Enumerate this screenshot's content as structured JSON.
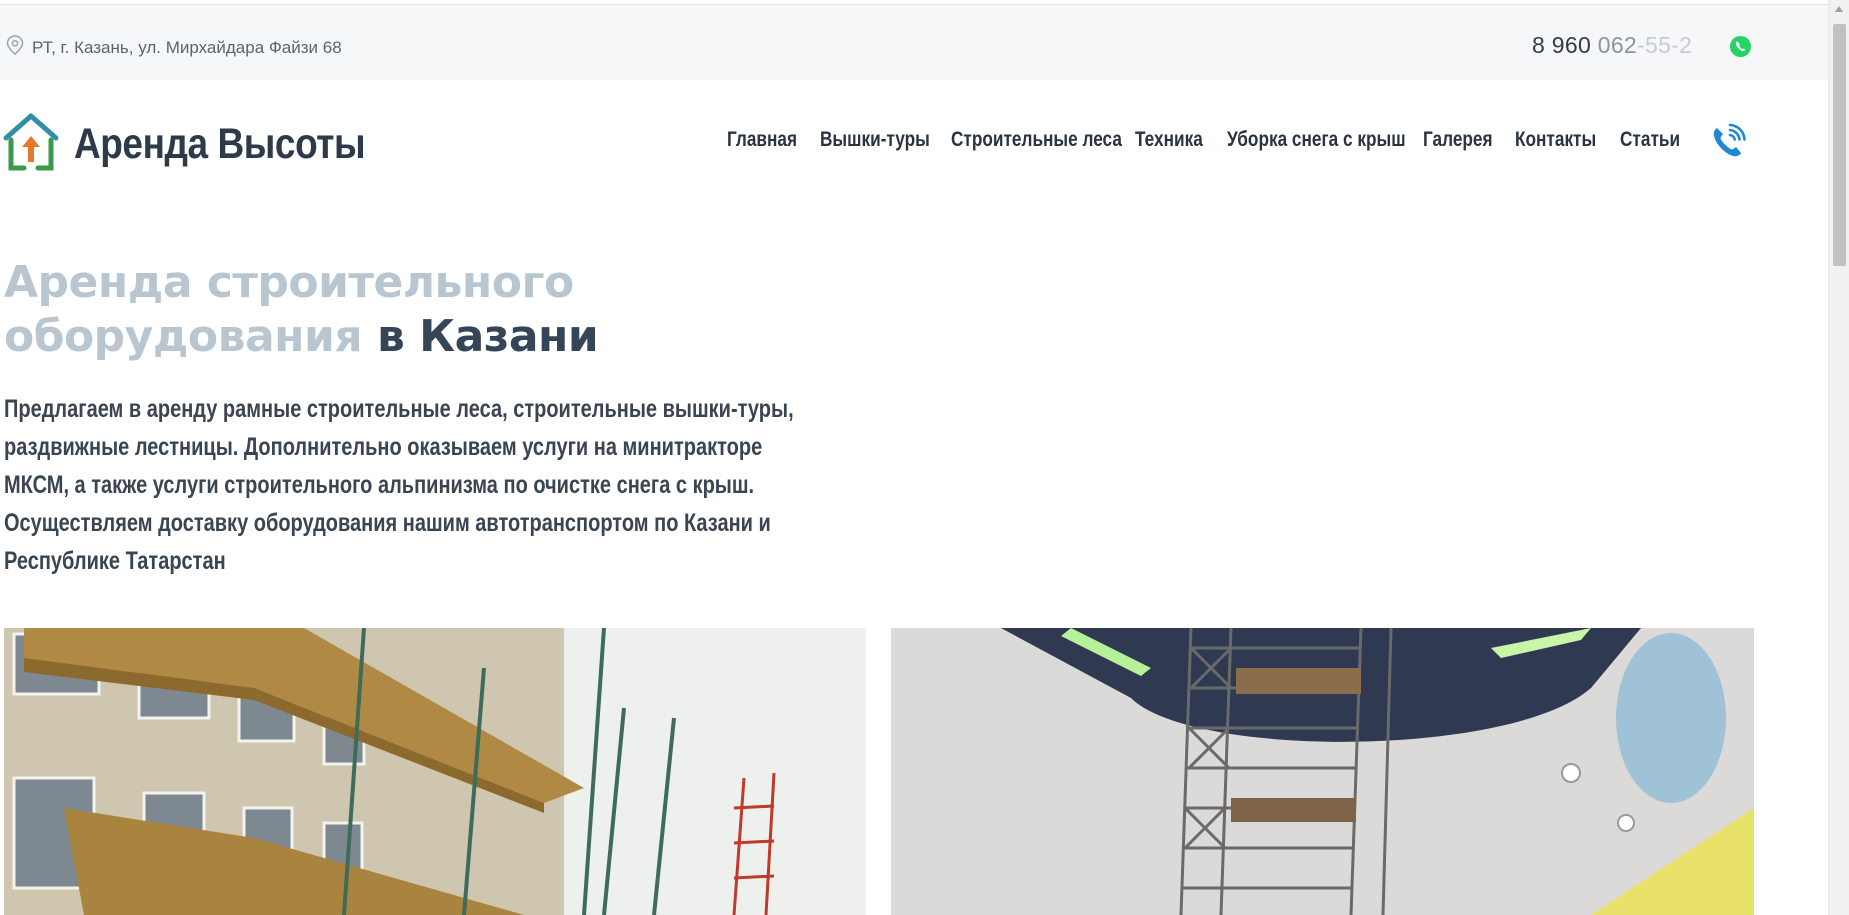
{
  "topbar": {
    "address": "РТ, г. Казань, ул. Мирхайдара Файзи 68",
    "phone_part_a": "8 960 ",
    "phone_part_b": "062",
    "phone_part_c": "-55-2",
    "location_icon": "location-pin-icon",
    "whatsapp_icon": "whatsapp-icon"
  },
  "logo": {
    "text": "Аренда Высоты",
    "icon": "house-up-arrow-logo"
  },
  "nav": {
    "items": [
      {
        "label": "Главная"
      },
      {
        "label": "Вышки-туры"
      },
      {
        "label": "Строительные леса"
      },
      {
        "label": "Техника"
      },
      {
        "label": "Уборка снега с крыш"
      },
      {
        "label": "Галерея"
      },
      {
        "label": "Контакты"
      },
      {
        "label": "Статьи"
      }
    ],
    "call_icon": "phone-call-icon"
  },
  "hero": {
    "title_light_line1": "Аренда строительного",
    "title_light_line2": "оборудования",
    "title_dark": " в Казани",
    "description": "Предлагаем в аренду рамные строительные леса, строительные вышки-туры, раздвижные лестницы. Дополнительно оказываем услуги на минитракторе МКСМ, а также услуги строительного альпинизма по очистке снега с крыш. Осуществляем доставку оборудования нашим автотранспортом по Казани и Республике Татарстан"
  },
  "colors": {
    "accent_blue": "#1e88d6",
    "logo_green": "#3a9a4a",
    "logo_orange": "#e8772e",
    "whatsapp_green": "#25d366"
  }
}
